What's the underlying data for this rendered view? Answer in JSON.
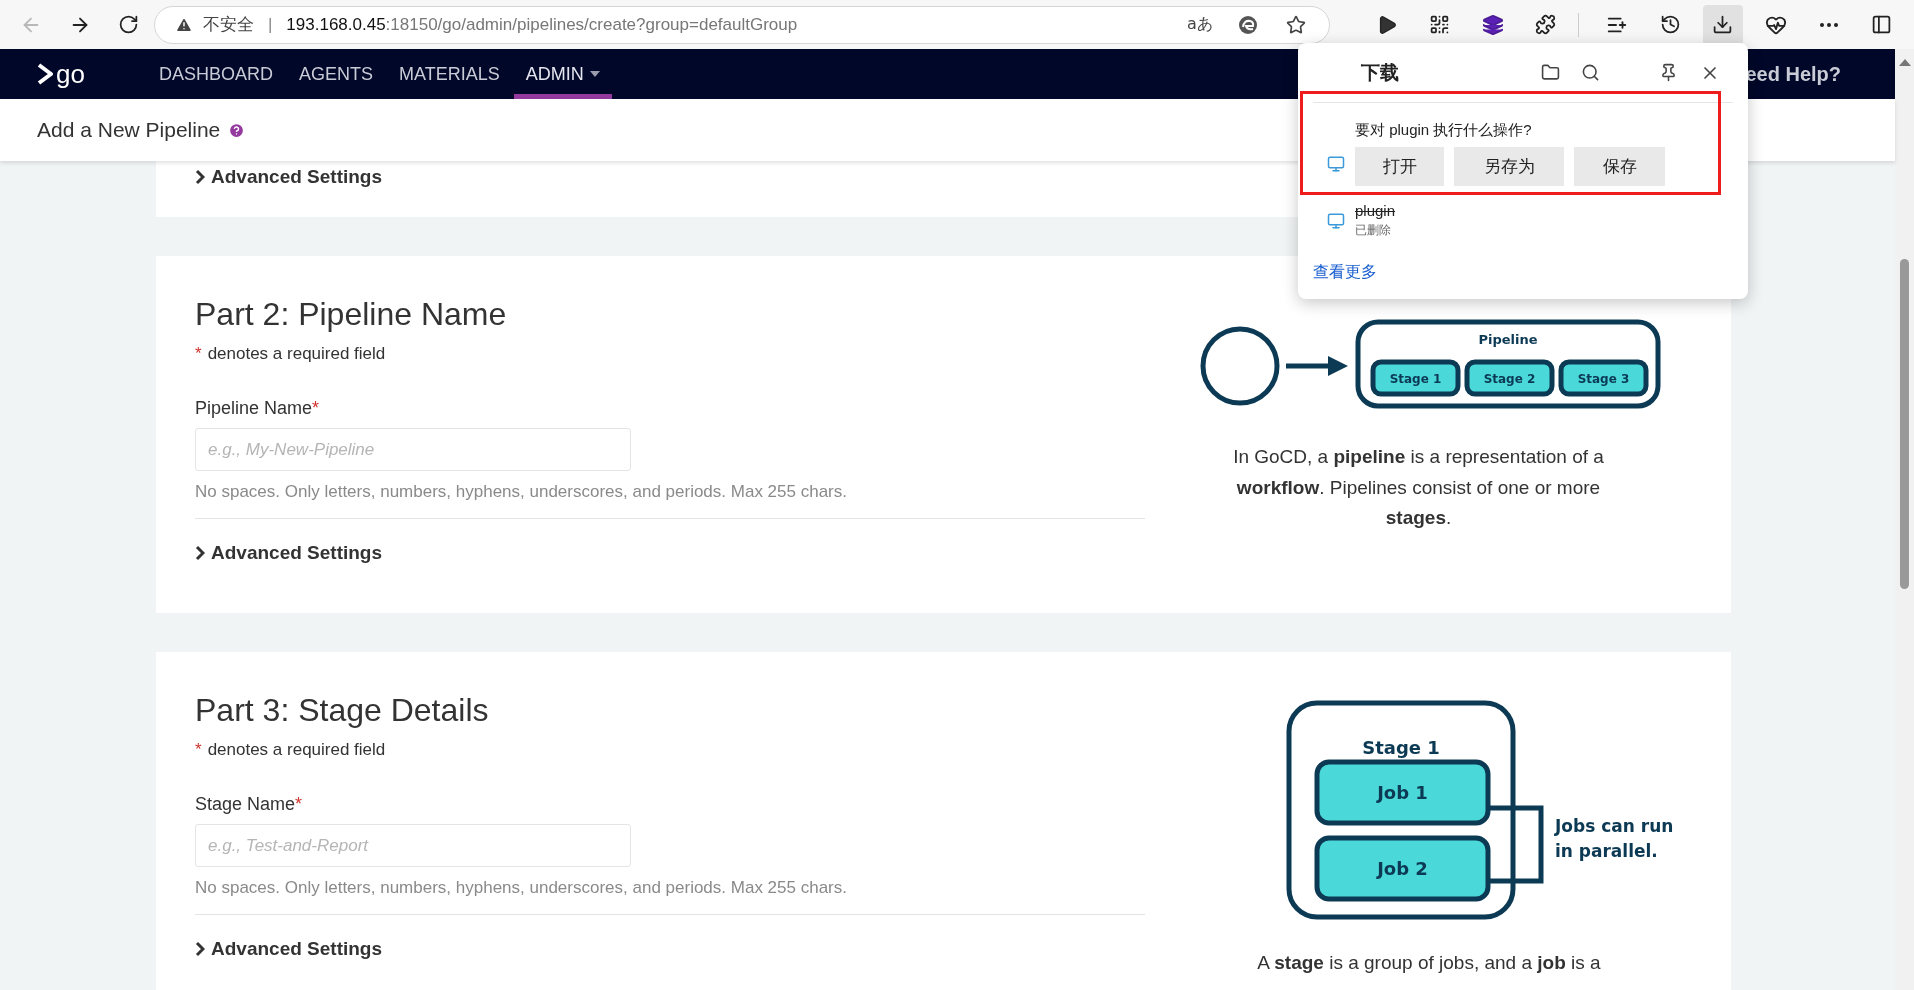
{
  "browser": {
    "back": {
      "disabled": true
    },
    "address": {
      "security_label": "不安全",
      "separator": "|",
      "host": "193.168.0.45",
      "path": ":18150/go/admin/pipelines/create?group=defaultGroup",
      "read_aloud": "aあ"
    },
    "toolbar": {
      "extensions": [
        {
          "kind": "play",
          "selected": false
        },
        {
          "kind": "qr",
          "selected": false
        },
        {
          "kind": "layers",
          "selected": false
        },
        {
          "kind": "puzzle",
          "selected": false
        }
      ],
      "main": [
        {
          "kind": "favorites",
          "selected": false
        },
        {
          "kind": "history",
          "selected": false
        },
        {
          "kind": "download",
          "selected": true
        },
        {
          "kind": "health",
          "selected": false
        },
        {
          "kind": "more",
          "selected": false
        },
        {
          "kind": "sidebar",
          "selected": false
        }
      ]
    }
  },
  "header": {
    "logo": "go",
    "nav": [
      {
        "label": "DASHBOARD",
        "selected": false,
        "dropdown": false
      },
      {
        "label": "AGENTS",
        "selected": false,
        "dropdown": false
      },
      {
        "label": "MATERIALS",
        "selected": false,
        "dropdown": false
      },
      {
        "label": "ADMIN",
        "selected": true,
        "dropdown": true
      }
    ],
    "help": "eed Help?"
  },
  "subheader": {
    "title": "Add a New Pipeline"
  },
  "sections": [
    {
      "advanced": "Advanced Settings"
    },
    {
      "title": "Part 2: Pipeline Name",
      "required_mark": "*",
      "required_note": "denotes a required field",
      "field_label": "Pipeline Name",
      "placeholder": "e.g., My-New-Pipeline",
      "help": "No spaces. Only letters, numbers, hyphens, underscores, and periods. Max 255 chars.",
      "advanced": "Advanced Settings",
      "diagram": {
        "kind": "pipeline",
        "title": "Pipeline",
        "nodes": [
          "Stage 1",
          "Stage 2",
          "Stage 3"
        ]
      },
      "caption": "In GoCD, a **pipeline** is a representation of a **workflow**. Pipelines consist of one or more **stages**."
    },
    {
      "title": "Part 3: Stage Details",
      "required_mark": "*",
      "required_note": "denotes a required field",
      "field_label": "Stage Name",
      "placeholder": "e.g., Test-and-Report",
      "help": "No spaces. Only letters, numbers, hyphens, underscores, and periods. Max 255 chars.",
      "advanced": "Advanced Settings",
      "diagram": {
        "kind": "stage",
        "title": "Stage 1",
        "nodes": [
          "Job 1",
          "Job 2"
        ],
        "note_lines": [
          "Jobs can run",
          "in parallel."
        ]
      },
      "caption": "A **stage** is a group of jobs, and a **job** is a"
    }
  ],
  "downloads": {
    "title": "下载",
    "items": [
      {
        "kind": "prompt",
        "question": "要对 plugin 执行什么操作?",
        "actions": [
          "打开",
          "另存为",
          "保存"
        ]
      },
      {
        "kind": "file",
        "name": "plugin",
        "deleted": true,
        "status": "已删除"
      }
    ],
    "more": "查看更多"
  }
}
